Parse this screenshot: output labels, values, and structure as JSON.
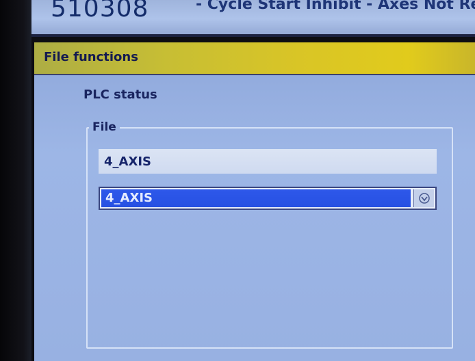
{
  "alarm": {
    "number": "510308",
    "text": "- Cycle Start Inhibit - Axes Not Refer"
  },
  "window": {
    "title": "File functions",
    "subtitle": "PLC status"
  },
  "file_group": {
    "label": "File",
    "name_field_value": "4_AXIS",
    "selected_file": "4_AXIS",
    "dropdown_icon": "dropdown-arrow-icon"
  },
  "colors": {
    "title_bar": "#d9c526",
    "selection": "#2e58ea",
    "window_bg": "#9bb4e4",
    "alarm_text": "#142c6a"
  }
}
